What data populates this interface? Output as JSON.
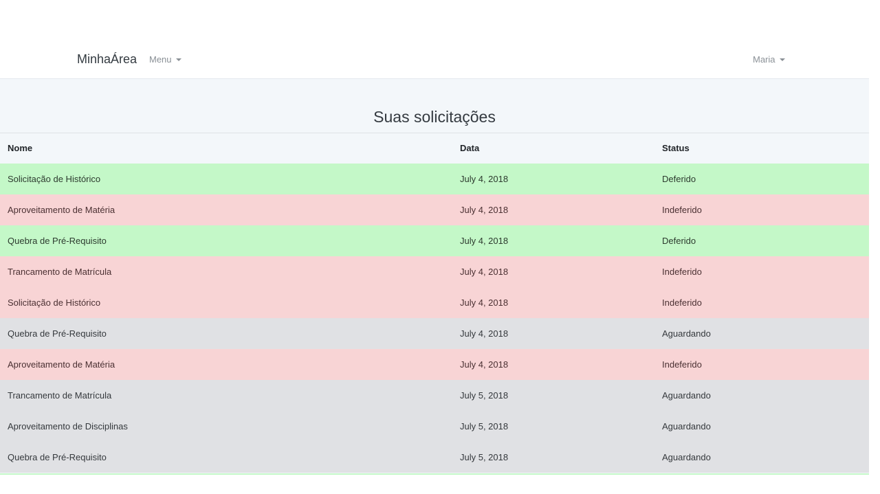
{
  "navbar": {
    "brand": "MinhaÁrea",
    "menu_label": "Menu",
    "user_label": "Maria"
  },
  "page": {
    "title": "Suas solicitações"
  },
  "table": {
    "headers": {
      "nome": "Nome",
      "data": "Data",
      "status": "Status"
    },
    "rows": [
      {
        "nome": "Solicitação de Histórico",
        "data": "July 4, 2018",
        "status": "Deferido"
      },
      {
        "nome": "Aproveitamento de Matéria",
        "data": "July 4, 2018",
        "status": "Indeferido"
      },
      {
        "nome": "Quebra de Pré-Requisito",
        "data": "July 4, 2018",
        "status": "Deferido"
      },
      {
        "nome": "Trancamento de Matrícula",
        "data": "July 4, 2018",
        "status": "Indeferido"
      },
      {
        "nome": "Solicitação de Histórico",
        "data": "July 4, 2018",
        "status": "Indeferido"
      },
      {
        "nome": "Quebra de Pré-Requisito",
        "data": "July 4, 2018",
        "status": "Aguardando"
      },
      {
        "nome": "Aproveitamento de Matéria",
        "data": "July 4, 2018",
        "status": "Indeferido"
      },
      {
        "nome": "Trancamento de Matrícula",
        "data": "July 5, 2018",
        "status": "Aguardando"
      },
      {
        "nome": "Aproveitamento de Disciplinas",
        "data": "July 5, 2018",
        "status": "Aguardando"
      },
      {
        "nome": "Quebra de Pré-Requisito",
        "data": "July 5, 2018",
        "status": "Aguardando"
      }
    ]
  },
  "colors": {
    "deferido": "#c4f8c8",
    "indeferido": "#f8d4d5",
    "aguardando": "#e0e1e4",
    "content_bg": "#f3f7fa"
  }
}
